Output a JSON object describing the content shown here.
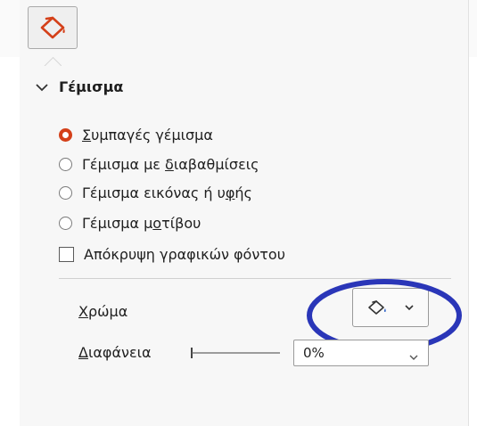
{
  "section": {
    "title": "Γέμισμα"
  },
  "fill_options": [
    {
      "pre": "",
      "ul": "Σ",
      "post": "υμπαγές γέμισμα",
      "selected": true
    },
    {
      "pre": "Γέμισμα με ",
      "ul": "δ",
      "post": "ιαβαθμίσεις",
      "selected": false
    },
    {
      "pre": "Γέμισμα εικόνας ή υ",
      "ul": "φ",
      "post": "ής",
      "selected": false
    },
    {
      "pre": "Γέμισμα μ",
      "ul": "ο",
      "post": "τίβου",
      "selected": false
    }
  ],
  "hide_background": {
    "label": "Απόκρυψη γραφικών φόντου",
    "checked": false
  },
  "color": {
    "ul": "Χ",
    "rest": "ρώμα"
  },
  "transparency": {
    "ul": "Δ",
    "rest": "ιαφάνεια",
    "value": "0%"
  },
  "colors": {
    "accent": "#d44019",
    "annotation": "#2a36b8"
  },
  "icons": {
    "tab": "paint-bucket-icon",
    "color": "paint-bucket-icon",
    "dropdown": "chevron-down-icon",
    "collapse": "chevron-down-icon"
  }
}
